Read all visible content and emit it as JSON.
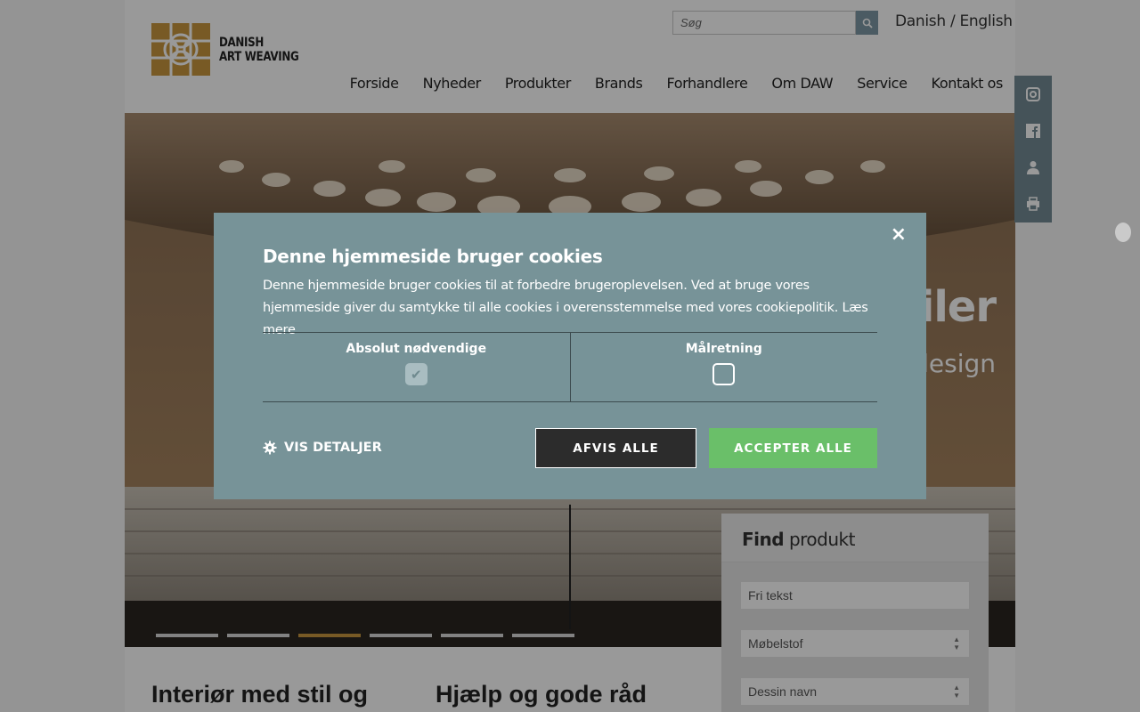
{
  "header": {
    "brand_line1": "DANISH",
    "brand_line2": "ART WEAVING",
    "search_placeholder": "Søg",
    "language_links": "Danish / English"
  },
  "nav": {
    "items": [
      "Forside",
      "Nyheder",
      "Produkter",
      "Brands",
      "Forhandlere",
      "Om DAW",
      "Service",
      "Kontakt os"
    ]
  },
  "hero": {
    "heading_fragment": "tiler",
    "subheading_fragment": "design",
    "slides_count": 6,
    "active_slide": 3
  },
  "social": {
    "icons": [
      "instagram-icon",
      "facebook-icon",
      "user-icon",
      "print-icon"
    ]
  },
  "finder": {
    "title_bold": "Find",
    "title_rest": "produkt",
    "text_placeholder": "Fri tekst",
    "select1_value": "Møbelstof",
    "select2_value": "Dessin navn"
  },
  "headlines": {
    "left": "Interiør med stil og",
    "middle": "Hjælp og gode råd"
  },
  "cookie": {
    "title": "Denne hjemmeside bruger cookies",
    "text": "Denne hjemmeside bruger cookies til at forbedre brugeroplevelsen. Ved at bruge vores hjemmeside giver du samtykke til alle cookies i overensstemmelse med vores cookiepolitik. Læs mere",
    "col1_label": "Absolut nødvendige",
    "col1_checked": true,
    "col2_label": "Målretning",
    "col2_checked": false,
    "details_label": "VIS DETALJER",
    "reject_label": "AFVIS ALLE",
    "accept_label": "ACCEPTER ALLE",
    "close_symbol": "×"
  },
  "colors": {
    "accent_gold": "#c8963e",
    "dialog_bg": "#779398",
    "accept_green": "#6abf69",
    "social_bg": "#748a94"
  }
}
